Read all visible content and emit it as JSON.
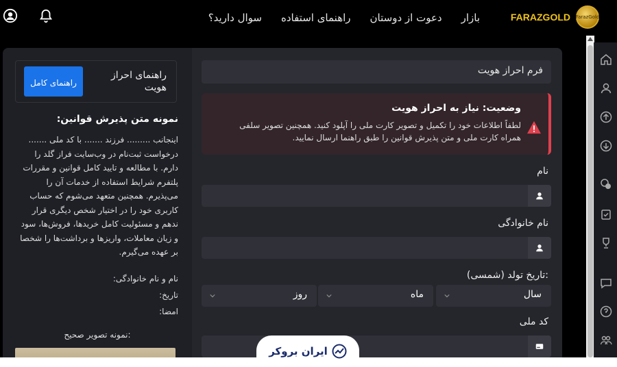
{
  "brand": {
    "name": "FARAZGOLD",
    "logo_text": "FarazGold"
  },
  "nav": [
    "بازار",
    "دعوت از دوستان",
    "راهنمای استفاده",
    "سوال دارید؟"
  ],
  "form": {
    "title": "فرم احراز هویت",
    "alert_title": "وضعیت: نیاز به احراز هویت",
    "alert_text": "لطفاً اطلاعات خود را تکمیل و تصویر کارت ملی را آپلود کنید. همچنین تصویر سلفی همراه کارت ملی و متن پذیرش قوانین را طبق راهنما ارسال نمایید.",
    "first_name_label": "نام",
    "last_name_label": "نام خانوادگی",
    "birth_label": "تاریخ تولد (شمسی):",
    "year": "سال",
    "month": "ماه",
    "day": "روز",
    "national_code_label": "کد ملی"
  },
  "guide": {
    "title": "راهنمای احراز هویت",
    "button": "راهنمای کامل",
    "terms_heading": "نمونه متن پذیرش قوانین:",
    "terms_text": "اینجانب ......... فرزند ....... با کد ملی ....... درخواست ثبت‌نام در وب‌سایت فراز گلد را دارم. با مطالعه و تایید کامل قوانین و مقررات پلتفرم شرایط استفاده از خدمات آن را می‌پذیرم. همچنین متعهد می‌شوم که حساب کاربری خود را در اختیار شخص دیگری قرار ندهم و مسئولیت کامل خریدها، فروش‌ها، سود و زیان معاملات، واریزها و برداشت‌ها را شخصا بر عهده می‌گیرم.",
    "name_line": "نام و نام خانوادگی:",
    "date_line": "تاریخ:",
    "sign_line": "امضا:",
    "sample_label": "نمونه تصویر صحیح:"
  },
  "watermark": "ایران بروکر",
  "colors": {
    "accent": "#1a73e8",
    "brand": "#f0c419",
    "alert": "#e0414d"
  }
}
